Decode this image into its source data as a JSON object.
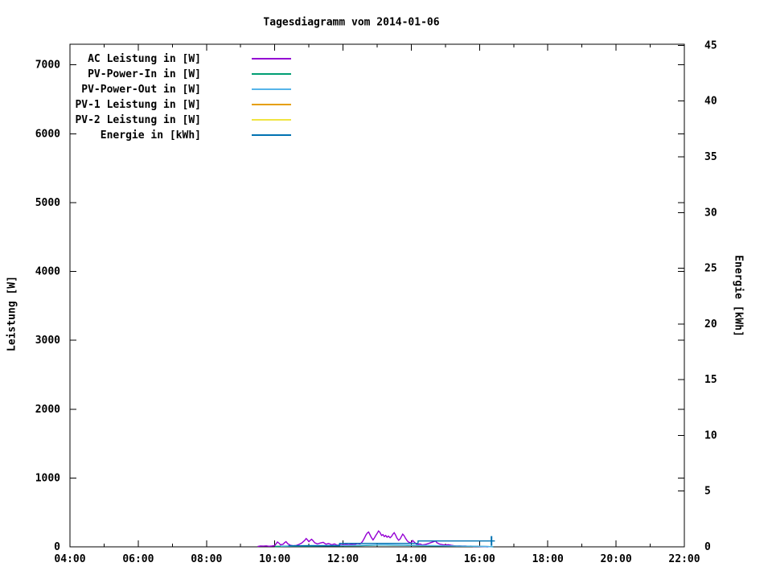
{
  "title": "Tagesdiagramm vom 2014-01-06",
  "colors": {
    "foreground": "#000000",
    "background": "#ffffff"
  },
  "chart_data": {
    "type": "line",
    "title": "Tagesdiagramm vom 2014-01-06",
    "legend_position": "top-left-inside",
    "grid": false,
    "x_axis": {
      "unit": "time",
      "range": [
        4,
        22
      ],
      "major_tick_hours": [
        4,
        6,
        8,
        10,
        12,
        14,
        16,
        18,
        20,
        22
      ],
      "minor_tick_hours": [
        5,
        7,
        9,
        11,
        13,
        15,
        17,
        19,
        21
      ],
      "tick_labels": [
        "04:00",
        "06:00",
        "08:00",
        "10:00",
        "12:00",
        "14:00",
        "16:00",
        "18:00",
        "20:00",
        "22:00"
      ]
    },
    "y_axes": [
      {
        "side": "left",
        "label": "Leistung [W]",
        "range": [
          0,
          7300
        ],
        "tick_values": [
          0,
          1000,
          2000,
          3000,
          4000,
          5000,
          6000,
          7000
        ],
        "tick_labels": [
          "0",
          "1000",
          "2000",
          "3000",
          "4000",
          "5000",
          "6000",
          "7000"
        ]
      },
      {
        "side": "right",
        "label": "Energie [kWh]",
        "range": [
          0,
          45.1
        ],
        "tick_values": [
          0,
          5,
          10,
          15,
          20,
          25,
          30,
          35,
          40,
          45
        ],
        "tick_labels": [
          "0",
          "5",
          "10",
          "15",
          "20",
          "25",
          "30",
          "35",
          "40",
          "45"
        ]
      }
    ],
    "series": [
      {
        "id": "ac-leistung",
        "name": "AC Leistung in [W]",
        "color": "#9400D3",
        "axis": "left",
        "points": [
          [
            9.5,
            5
          ],
          [
            9.58,
            12
          ],
          [
            9.67,
            10
          ],
          [
            9.75,
            14
          ],
          [
            9.83,
            8
          ],
          [
            9.92,
            12
          ],
          [
            10.0,
            18
          ],
          [
            10.04,
            45
          ],
          [
            10.08,
            70
          ],
          [
            10.13,
            50
          ],
          [
            10.17,
            28
          ],
          [
            10.25,
            40
          ],
          [
            10.29,
            62
          ],
          [
            10.33,
            75
          ],
          [
            10.38,
            45
          ],
          [
            10.46,
            22
          ],
          [
            10.54,
            15
          ],
          [
            10.63,
            20
          ],
          [
            10.71,
            35
          ],
          [
            10.79,
            55
          ],
          [
            10.88,
            95
          ],
          [
            10.92,
            120
          ],
          [
            10.96,
            100
          ],
          [
            11.0,
            75
          ],
          [
            11.04,
            95
          ],
          [
            11.08,
            110
          ],
          [
            11.13,
            85
          ],
          [
            11.17,
            60
          ],
          [
            11.25,
            42
          ],
          [
            11.33,
            55
          ],
          [
            11.42,
            65
          ],
          [
            11.5,
            38
          ],
          [
            11.58,
            48
          ],
          [
            11.67,
            30
          ],
          [
            11.75,
            42
          ],
          [
            11.83,
            25
          ],
          [
            11.92,
            32
          ],
          [
            12.0,
            28
          ],
          [
            12.08,
            35
          ],
          [
            12.17,
            30
          ],
          [
            12.25,
            38
          ],
          [
            12.33,
            32
          ],
          [
            12.42,
            48
          ],
          [
            12.5,
            42
          ],
          [
            12.54,
            60
          ],
          [
            12.58,
            85
          ],
          [
            12.63,
            130
          ],
          [
            12.67,
            170
          ],
          [
            12.71,
            200
          ],
          [
            12.75,
            215
          ],
          [
            12.79,
            175
          ],
          [
            12.83,
            135
          ],
          [
            12.88,
            100
          ],
          [
            12.92,
            130
          ],
          [
            12.96,
            165
          ],
          [
            13.0,
            195
          ],
          [
            13.04,
            230
          ],
          [
            13.08,
            210
          ],
          [
            13.13,
            165
          ],
          [
            13.17,
            178
          ],
          [
            13.21,
            150
          ],
          [
            13.25,
            165
          ],
          [
            13.29,
            140
          ],
          [
            13.33,
            155
          ],
          [
            13.38,
            132
          ],
          [
            13.42,
            150
          ],
          [
            13.46,
            182
          ],
          [
            13.5,
            205
          ],
          [
            13.54,
            172
          ],
          [
            13.58,
            128
          ],
          [
            13.63,
            95
          ],
          [
            13.67,
            112
          ],
          [
            13.71,
            148
          ],
          [
            13.75,
            185
          ],
          [
            13.79,
            162
          ],
          [
            13.83,
            125
          ],
          [
            13.88,
            88
          ],
          [
            13.92,
            70
          ],
          [
            13.96,
            62
          ],
          [
            14.0,
            58
          ],
          [
            14.04,
            92
          ],
          [
            14.08,
            72
          ],
          [
            14.13,
            48
          ],
          [
            14.17,
            32
          ],
          [
            14.25,
            42
          ],
          [
            14.33,
            28
          ],
          [
            14.42,
            36
          ],
          [
            14.5,
            48
          ],
          [
            14.58,
            62
          ],
          [
            14.67,
            78
          ],
          [
            14.71,
            85
          ],
          [
            14.75,
            60
          ],
          [
            14.83,
            40
          ],
          [
            14.92,
            32
          ],
          [
            15.0,
            26
          ],
          [
            15.08,
            32
          ],
          [
            15.17,
            22
          ],
          [
            15.25,
            16
          ],
          [
            15.33,
            12
          ],
          [
            15.42,
            14
          ],
          [
            15.5,
            10
          ],
          [
            15.58,
            12
          ],
          [
            15.67,
            8
          ],
          [
            15.75,
            10
          ],
          [
            15.83,
            6
          ],
          [
            15.92,
            8
          ],
          [
            16.0,
            5
          ],
          [
            16.08,
            4
          ],
          [
            16.17,
            2
          ],
          [
            16.25,
            0
          ]
        ]
      },
      {
        "id": "pv-power-in",
        "name": "PV-Power-In in [W]",
        "color": "#009E73",
        "axis": "left",
        "points": [
          [
            10.0,
            6
          ],
          [
            10.5,
            10
          ],
          [
            11.0,
            12
          ],
          [
            11.5,
            14
          ],
          [
            12.0,
            15
          ],
          [
            12.5,
            18
          ],
          [
            12.9,
            24
          ],
          [
            13.1,
            28
          ],
          [
            13.4,
            26
          ],
          [
            13.8,
            22
          ],
          [
            14.2,
            18
          ],
          [
            14.8,
            14
          ],
          [
            15.4,
            10
          ],
          [
            16.0,
            7
          ],
          [
            16.35,
            4
          ],
          [
            16.4,
            0
          ]
        ]
      },
      {
        "id": "pv-power-out",
        "name": "PV-Power-Out in [W]",
        "color": "#56B4E9",
        "axis": "left",
        "points": [
          [
            10.17,
            10
          ],
          [
            10.6,
            14
          ],
          [
            11.1,
            17
          ],
          [
            11.6,
            19
          ],
          [
            12.1,
            20
          ],
          [
            12.6,
            24
          ],
          [
            13.0,
            30
          ],
          [
            13.3,
            32
          ],
          [
            13.7,
            27
          ],
          [
            14.1,
            22
          ],
          [
            14.7,
            18
          ],
          [
            15.3,
            13
          ],
          [
            15.9,
            9
          ],
          [
            16.2,
            6
          ],
          [
            16.4,
            0
          ]
        ]
      },
      {
        "id": "pv1-leistung",
        "name": "PV-1 Leistung in [W]",
        "color": "#E69F00",
        "axis": "left",
        "points": []
      },
      {
        "id": "pv2-leistung",
        "name": "PV-2 Leistung in [W]",
        "color": "#F0E442",
        "axis": "left",
        "points": []
      },
      {
        "id": "energie",
        "name": "Energie in [kWh]",
        "color": "#0072B2",
        "axis": "right",
        "points": [
          [
            10.4,
            0.1
          ],
          [
            11.9,
            0.1
          ],
          [
            11.9,
            0.31
          ],
          [
            14.2,
            0.31
          ],
          [
            14.2,
            0.53
          ],
          [
            16.45,
            0.53
          ]
        ],
        "end_tick": {
          "x": 16.35,
          "value": 0.53
        }
      }
    ]
  }
}
